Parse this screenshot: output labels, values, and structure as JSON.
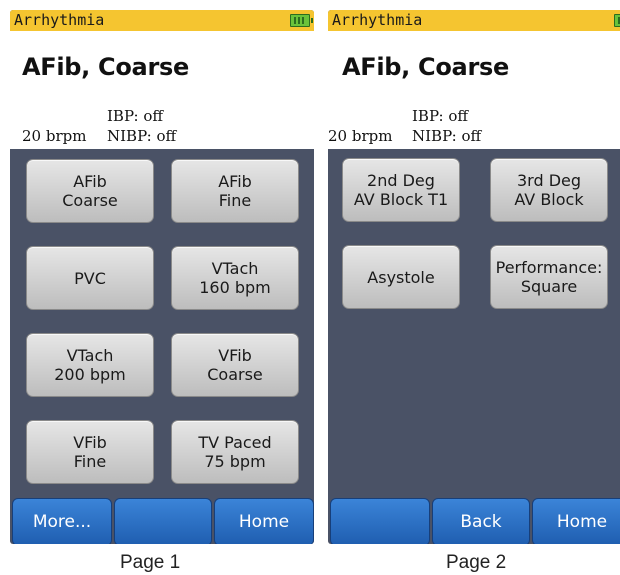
{
  "screens": [
    {
      "title_bar": "Arrhythmia",
      "page_title": "AFib, Coarse",
      "ibp": "IBP: off",
      "rate": "20 brpm",
      "nibp": "NIBP: off",
      "buttons": [
        "AFib\nCoarse",
        "AFib\nFine",
        "PVC",
        "VTach\n160 bpm",
        "VTach\n200 bpm",
        "VFib\nCoarse",
        "VFib\nFine",
        "TV Paced\n75 bpm"
      ],
      "softkeys": [
        "More...",
        "",
        "Home"
      ]
    },
    {
      "title_bar": "Arrhythmia",
      "page_title": "AFib, Coarse",
      "ibp": "IBP: off",
      "rate": "20 brpm",
      "nibp": "NIBP: off",
      "buttons": [
        "2nd Deg\nAV Block T1",
        "3rd Deg\nAV Block",
        "Asystole",
        "Performance:\nSquare"
      ],
      "softkeys": [
        "",
        "Back",
        "Home"
      ]
    }
  ],
  "captions": [
    "Page 1",
    "Page 2"
  ],
  "colors": {
    "title_bar": "#f5c530",
    "screen_bg": "#4a5266",
    "softkey": "#2a6fc6",
    "battery": "#6ac33b"
  }
}
